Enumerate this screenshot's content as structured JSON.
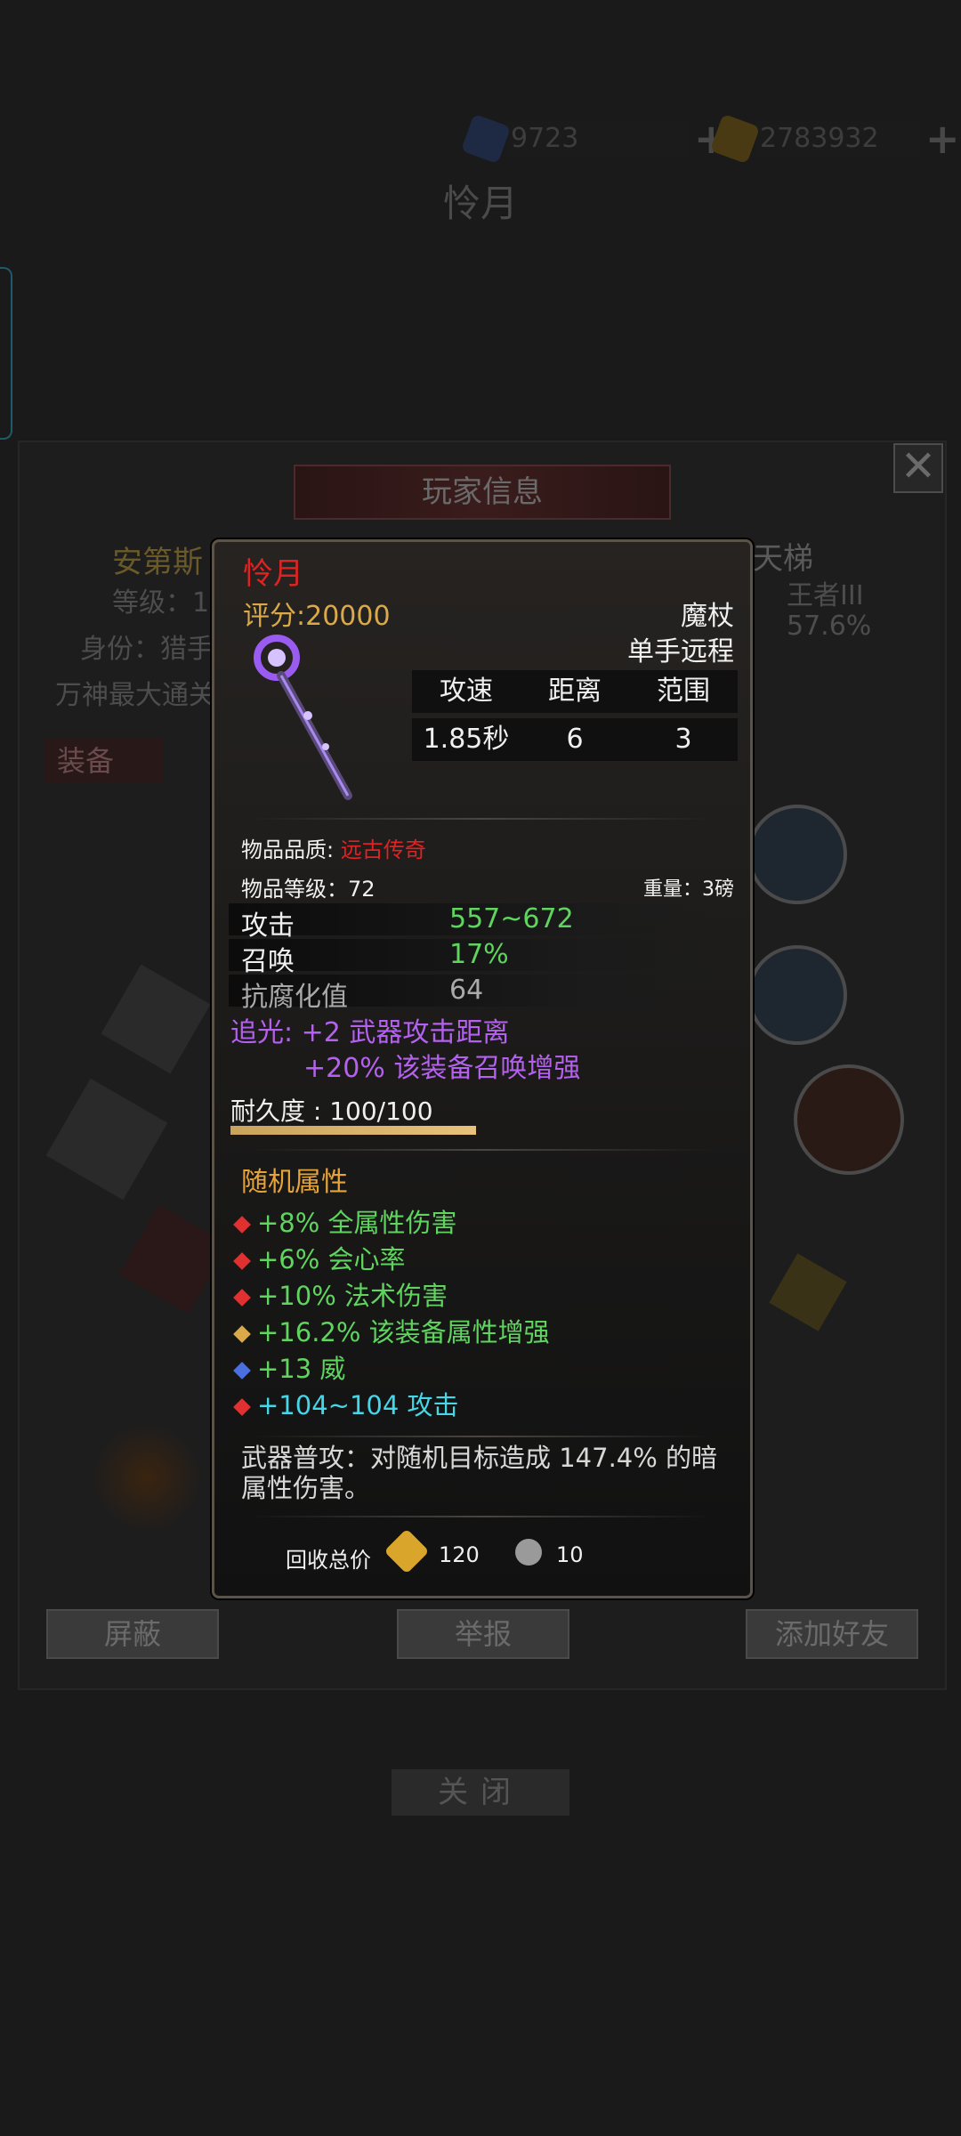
{
  "background": {
    "currency": [
      {
        "icon": "blue-crystal-icon",
        "value": "9723"
      },
      {
        "icon": "gold-crystal-icon",
        "value": "2783932"
      }
    ],
    "page_title": "怜月",
    "panel_title": "玩家信息",
    "player_name": "安第斯",
    "level_label": "等级：1",
    "identity_label": "身份：猎手",
    "max_pass_label": "万神最大通关",
    "ladder_label": "天梯",
    "rank_value": "王者III",
    "rate_value": "57.6%",
    "equip_section": "装备",
    "buttons": {
      "block": "屏蔽",
      "report": "举报",
      "add_friend": "添加好友"
    },
    "close": "关闭"
  },
  "tooltip": {
    "name": "怜月",
    "score": "评分:20000",
    "weapon_type": "魔杖",
    "hand_type": "单手远程",
    "stats_headers": [
      "攻速",
      "距离",
      "范围"
    ],
    "stats_values": [
      "1.85秒",
      "6",
      "3"
    ],
    "quality_label": "物品品质:",
    "quality_value": "远古传奇",
    "item_level": "物品等级：72",
    "weight": "重量：3磅",
    "attributes": [
      {
        "name": "攻击",
        "value": "557~672"
      },
      {
        "name": "召唤",
        "value": "17%"
      },
      {
        "name": "抗腐化值",
        "value": "64"
      }
    ],
    "chase_light_1": "追光: +2 武器攻击距离",
    "chase_light_2": "+20% 该装备召唤增强",
    "durability_label": "耐久度 : 100/100",
    "durability_fraction": 1.0,
    "random_title": "随机属性",
    "random_attrs": [
      {
        "text": "+8% 全属性伤害",
        "gem": "red"
      },
      {
        "text": "+6% 会心率",
        "gem": "red"
      },
      {
        "text": "+10% 法术伤害",
        "gem": "red"
      },
      {
        "text": "+16.2% 该装备属性增强",
        "gem": "gold"
      },
      {
        "text": "+13 威",
        "gem": "blue"
      },
      {
        "text": "+104~104 攻击",
        "gem": "red"
      }
    ],
    "skill_desc": "武器普攻：对随机目标造成 147.4% 的暗属性伤害。",
    "recycle_label": "回收总价",
    "recycle_gold": "120",
    "recycle_silver": "10"
  },
  "colors": {
    "legendary_red": "#e02222",
    "score_gold": "#d9a94a",
    "purple": "#b561ef",
    "green": "#5fd55f",
    "cyan": "#45d6e8"
  }
}
